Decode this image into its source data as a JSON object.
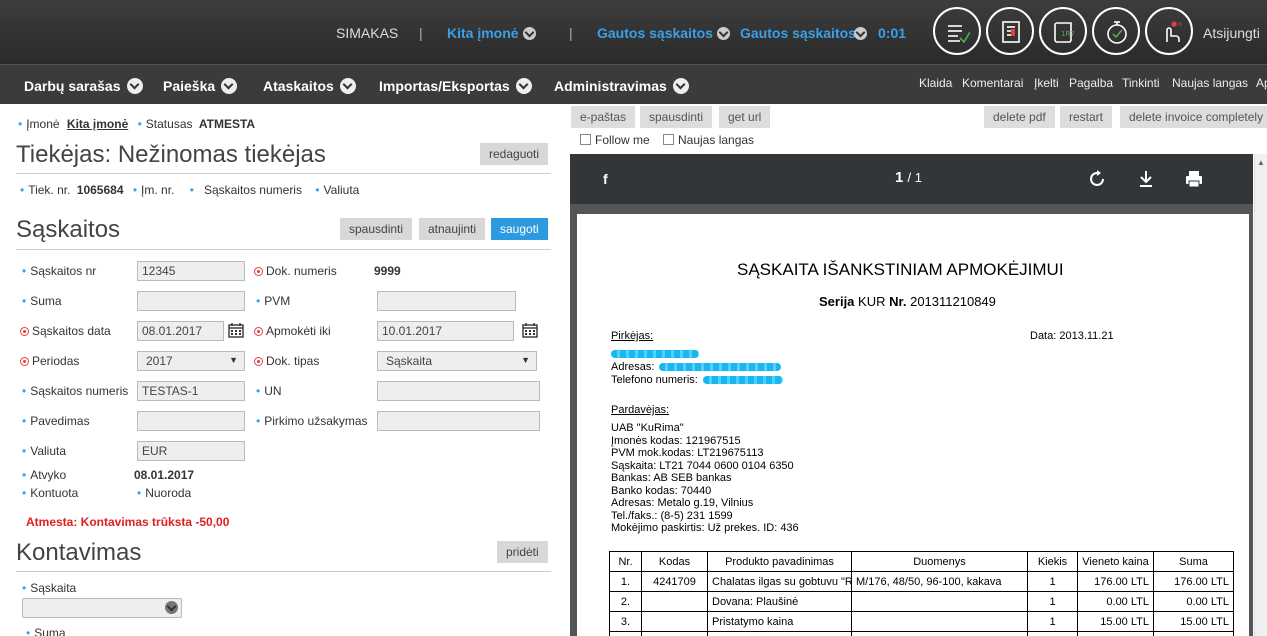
{
  "topbar": {
    "simakas": "SIMAKAS",
    "sep1": "|",
    "company": "Kita įmonė",
    "sep2": "|",
    "received1": "Gautos sąskaitos",
    "received2": "Gautos sąskaitos",
    "timer": "0:01",
    "logout": "Atsijungti",
    "icons": [
      "list-check-icon",
      "document-icon",
      "scroll-icon",
      "stopwatch-check-icon",
      "pointer-icon"
    ]
  },
  "nav": {
    "menus": [
      "Darbų sarašas",
      "Paieška",
      "Ataskaitos",
      "Importas/Eksportas",
      "Administravimas"
    ],
    "links": [
      "Klaida",
      "Komentarai",
      "Įkelti",
      "Pagalba",
      "Tinkinti",
      "Naujas langas",
      "Ap"
    ]
  },
  "header": {
    "company_label": "Įmonė",
    "company_value": "Kita įmonė",
    "status_label": "Statusas",
    "status_value": "ATMESTA"
  },
  "supplier": {
    "title": "Tiekėjas: Nežinomas tiekėjas",
    "edit": "redaguoti",
    "tiek_label": "Tiek. nr.",
    "tiek_value": "1065684",
    "im_label": "Įm. nr.",
    "invnum_label": "Sąskaitos numeris",
    "currency_label": "Valiuta"
  },
  "invoices": {
    "title": "Sąskaitos",
    "btn_print": "spausdinti",
    "btn_refresh": "atnaujinti",
    "btn_save": "saugoti",
    "fields": {
      "nr_label": "Sąskaitos nr",
      "nr_value": "12345",
      "doknr_label": "Dok. numeris",
      "doknr_value": "9999",
      "suma_label": "Suma",
      "pvm_label": "PVM",
      "date_label": "Sąskaitos data",
      "date_value": "08.01.2017",
      "pay_label": "Apmokėti iki",
      "pay_value": "10.01.2017",
      "period_label": "Periodas",
      "period_value": "2017",
      "doktype_label": "Dok. tipas",
      "doktype_value": "Sąskaita",
      "number_label": "Sąskaitos numeris",
      "number_value": "TESTAS-1",
      "un_label": "UN",
      "transfer_label": "Pavedimas",
      "order_label": "Pirkimo užsakymas",
      "currency_label": "Valiuta",
      "currency_value": "EUR",
      "arrived_label": "Atvyko",
      "arrived_value": "08.01.2017",
      "posted_label": "Kontuota",
      "ref_label": "Nuoroda"
    },
    "error": "Atmesta: Kontavimas trūksta -50,00"
  },
  "posting": {
    "title": "Kontavimas",
    "btn_add": "pridėti",
    "account_label": "Sąskaita",
    "sum_label": "Suma"
  },
  "right": {
    "buttons_left": [
      "e-paštas",
      "spausdinti",
      "get url"
    ],
    "buttons_right": [
      "delete pdf",
      "restart",
      "delete invoice completely"
    ],
    "follow": "Follow me",
    "new_window": "Naujas langas"
  },
  "viewer": {
    "menu_glyph": "f",
    "page_current": "1",
    "page_total": "/ 1"
  },
  "pdf": {
    "title": "SĄSKAITA IŠANKSTINIAM APMOKĖJIMUI",
    "series_prefix": "Serija",
    "series": "KUR",
    "nr_prefix": "Nr.",
    "nr": "201311210849",
    "buyer_label": "Pirkėjas:",
    "date": "Data: 2013.11.21",
    "address_label": "Adresas:",
    "phone_label": "Telefono numeris:",
    "seller_label": "Pardavėjas:",
    "seller_lines": [
      "UAB \"KuRima\"",
      "Įmonės kodas: 121967515",
      "PVM mok.kodas: LT219675113",
      "Sąskaita: LT21 7044 0600 0104 6350",
      "Bankas: AB SEB bankas",
      "Banko kodas: 70440",
      "Adresas: Metalo g.19, Vilnius",
      "Tel./faks.: (8-5) 231 1599",
      "Mokėjimo paskirtis: Už prekes. ID: 436"
    ],
    "table": {
      "headers": [
        "Nr.",
        "Kodas",
        "Produkto pavadinimas",
        "Duomenys",
        "Kiekis",
        "Vieneto kaina",
        "Suma"
      ],
      "rows": [
        [
          "1.",
          "4241709",
          "Chalatas ilgas su gobtuvu \"R",
          "M/176, 48/50, 96-100, kakava",
          "1",
          "176.00 LTL",
          "176.00 LTL"
        ],
        [
          "2.",
          "",
          "Dovana: Plaušinė",
          "",
          "1",
          "0.00 LTL",
          "0.00 LTL"
        ],
        [
          "3.",
          "",
          "Pristatymo kaina",
          "",
          "1",
          "15.00 LTL",
          "15.00 LTL"
        ]
      ]
    }
  }
}
